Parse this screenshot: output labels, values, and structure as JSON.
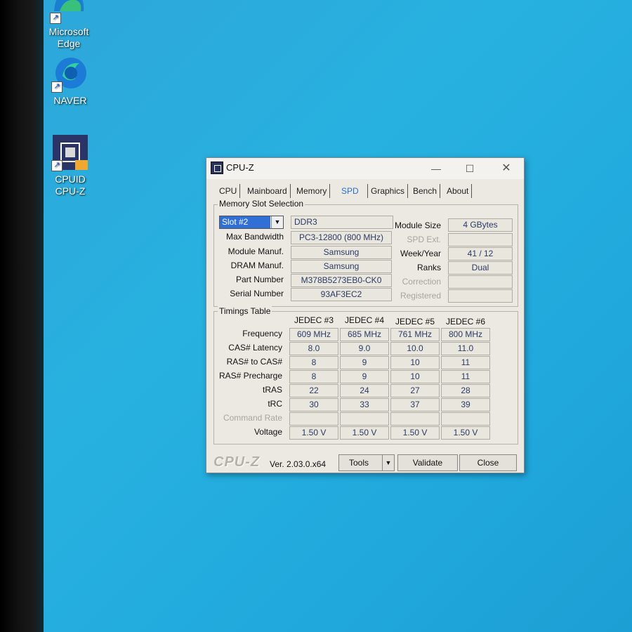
{
  "desktop": {
    "icons": [
      {
        "label_line1": "Microsoft",
        "label_line2": "Edge",
        "icon": "edge-icon"
      },
      {
        "label_line1": "NAVER",
        "label_line2": "",
        "icon": "naver-whale-icon"
      },
      {
        "label_line1": "CPUID",
        "label_line2": "CPU-Z",
        "icon": "cpuz-icon"
      }
    ]
  },
  "window": {
    "title": "CPU-Z",
    "tabs": [
      "CPU",
      "Mainboard",
      "Memory",
      "SPD",
      "Graphics",
      "Bench",
      "About"
    ],
    "active_tab": "SPD",
    "slot_group": {
      "label": "Memory Slot Selection",
      "slot_value": "Slot #2",
      "memory_type": "DDR3",
      "rows": [
        {
          "label": "Max Bandwidth",
          "value": "PC3-12800 (800 MHz)"
        },
        {
          "label": "Module Manuf.",
          "value": "Samsung"
        },
        {
          "label": "DRAM Manuf.",
          "value": "Samsung"
        },
        {
          "label": "Part Number",
          "value": "M378B5273EB0-CK0"
        },
        {
          "label": "Serial Number",
          "value": "93AF3EC2"
        }
      ],
      "right_rows": [
        {
          "label": "Module Size",
          "value": "4 GBytes"
        },
        {
          "label": "SPD Ext.",
          "value": ""
        },
        {
          "label": "Week/Year",
          "value": "41 / 12"
        },
        {
          "label": "Ranks",
          "value": "Dual"
        },
        {
          "label": "Correction",
          "value": ""
        },
        {
          "label": "Registered",
          "value": ""
        }
      ]
    },
    "timings": {
      "label": "Timings Table",
      "columns": [
        "JEDEC #3",
        "JEDEC #4",
        "JEDEC #5",
        "JEDEC #6"
      ],
      "rows": [
        {
          "label": "Frequency",
          "values": [
            "609 MHz",
            "685 MHz",
            "761 MHz",
            "800 MHz"
          ]
        },
        {
          "label": "CAS# Latency",
          "values": [
            "8.0",
            "9.0",
            "10.0",
            "11.0"
          ]
        },
        {
          "label": "RAS# to CAS#",
          "values": [
            "8",
            "9",
            "10",
            "11"
          ]
        },
        {
          "label": "RAS# Precharge",
          "values": [
            "8",
            "9",
            "10",
            "11"
          ]
        },
        {
          "label": "tRAS",
          "values": [
            "22",
            "24",
            "27",
            "28"
          ]
        },
        {
          "label": "tRC",
          "values": [
            "30",
            "33",
            "37",
            "39"
          ]
        },
        {
          "label": "Command Rate",
          "values": [
            "",
            "",
            "",
            ""
          ]
        },
        {
          "label": "Voltage",
          "values": [
            "1.50 V",
            "1.50 V",
            "1.50 V",
            "1.50 V"
          ]
        }
      ]
    },
    "footer": {
      "logo": "CPU-Z",
      "version": "Ver. 2.03.0.x64",
      "tools_label": "Tools",
      "validate_label": "Validate",
      "close_label": "Close"
    }
  }
}
